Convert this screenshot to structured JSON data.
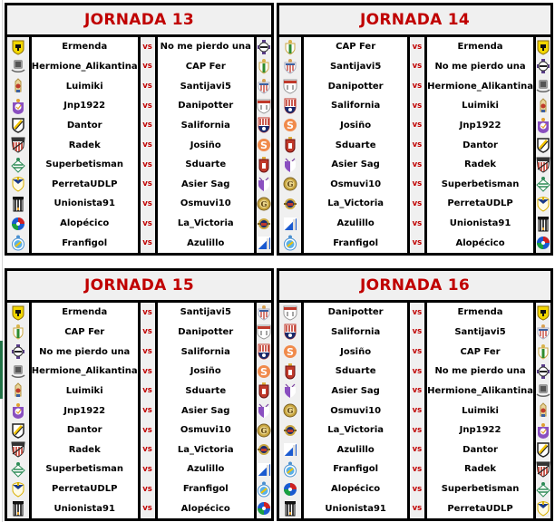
{
  "vs_label": "vs",
  "jornadas": [
    {
      "title": "JORNADA 13",
      "matches": [
        {
          "home": "Ermenda",
          "home_icon": "ermenda-crest-icon",
          "away": "No me pierdo una",
          "away_icon": "no-me-pierdo-una-crest-icon"
        },
        {
          "home": "Hermione_Alikantina",
          "home_icon": "hermione-alikantina-crest-icon",
          "away": "CAP Fer",
          "away_icon": "cap-fer-crest-icon"
        },
        {
          "home": "Luimiki",
          "home_icon": "luimiki-crest-icon",
          "away": "Santijavi5",
          "away_icon": "santijavi5-crest-icon"
        },
        {
          "home": "Jnp1922",
          "home_icon": "jnp1922-crest-icon",
          "away": "Danipotter",
          "away_icon": "danipotter-crest-icon"
        },
        {
          "home": "Dantor",
          "home_icon": "dantor-crest-icon",
          "away": "Salifornia",
          "away_icon": "salifornia-crest-icon"
        },
        {
          "home": "Radek",
          "home_icon": "radek-crest-icon",
          "away": "Josiño",
          "away_icon": "josino-crest-icon"
        },
        {
          "home": "Superbetisman",
          "home_icon": "superbetisman-crest-icon",
          "away": "Sduarte",
          "away_icon": "sduarte-crest-icon"
        },
        {
          "home": "PerretaUDLP",
          "home_icon": "perretaudlp-crest-icon",
          "away": "Asier Sag",
          "away_icon": "asier-sag-crest-icon"
        },
        {
          "home": "Unionista91",
          "home_icon": "unionista91-crest-icon",
          "away": "Osmuvi10",
          "away_icon": "osmuvi10-crest-icon"
        },
        {
          "home": "Alopécico",
          "home_icon": "alopecico-crest-icon",
          "away": "La_Victoria",
          "away_icon": "la-victoria-crest-icon"
        },
        {
          "home": "Franfigol",
          "home_icon": "franfigol-crest-icon",
          "away": "Azulillo",
          "away_icon": "azulillo-crest-icon"
        }
      ]
    },
    {
      "title": "JORNADA 14",
      "matches": [
        {
          "home": "CAP Fer",
          "home_icon": "cap-fer-crest-icon",
          "away": "Ermenda",
          "away_icon": "ermenda-crest-icon"
        },
        {
          "home": "Santijavi5",
          "home_icon": "santijavi5-crest-icon",
          "away": "No me pierdo una",
          "away_icon": "no-me-pierdo-una-crest-icon"
        },
        {
          "home": "Danipotter",
          "home_icon": "danipotter-crest-icon",
          "away": "Hermione_Alikantina",
          "away_icon": "hermione-alikantina-crest-icon"
        },
        {
          "home": "Salifornia",
          "home_icon": "salifornia-crest-icon",
          "away": "Luimiki",
          "away_icon": "luimiki-crest-icon"
        },
        {
          "home": "Josiño",
          "home_icon": "josino-crest-icon",
          "away": "Jnp1922",
          "away_icon": "jnp1922-crest-icon"
        },
        {
          "home": "Sduarte",
          "home_icon": "sduarte-crest-icon",
          "away": "Dantor",
          "away_icon": "dantor-crest-icon"
        },
        {
          "home": "Asier Sag",
          "home_icon": "asier-sag-crest-icon",
          "away": "Radek",
          "away_icon": "radek-crest-icon"
        },
        {
          "home": "Osmuvi10",
          "home_icon": "osmuvi10-crest-icon",
          "away": "Superbetisman",
          "away_icon": "superbetisman-crest-icon"
        },
        {
          "home": "La_Victoria",
          "home_icon": "la-victoria-crest-icon",
          "away": "PerretaUDLP",
          "away_icon": "perretaudlp-crest-icon"
        },
        {
          "home": "Azulillo",
          "home_icon": "azulillo-crest-icon",
          "away": "Unionista91",
          "away_icon": "unionista91-crest-icon"
        },
        {
          "home": "Franfigol",
          "home_icon": "franfigol-crest-icon",
          "away": "Alopécico",
          "away_icon": "alopecico-crest-icon"
        }
      ]
    },
    {
      "title": "JORNADA 15",
      "matches": [
        {
          "home": "Ermenda",
          "home_icon": "ermenda-crest-icon",
          "away": "Santijavi5",
          "away_icon": "santijavi5-crest-icon"
        },
        {
          "home": "CAP Fer",
          "home_icon": "cap-fer-crest-icon",
          "away": "Danipotter",
          "away_icon": "danipotter-crest-icon"
        },
        {
          "home": "No me pierdo una",
          "home_icon": "no-me-pierdo-una-crest-icon",
          "away": "Salifornia",
          "away_icon": "salifornia-crest-icon"
        },
        {
          "home": "Hermione_Alikantina",
          "home_icon": "hermione-alikantina-crest-icon",
          "away": "Josiño",
          "away_icon": "josino-crest-icon"
        },
        {
          "home": "Luimiki",
          "home_icon": "luimiki-crest-icon",
          "away": "Sduarte",
          "away_icon": "sduarte-crest-icon"
        },
        {
          "home": "Jnp1922",
          "home_icon": "jnp1922-crest-icon",
          "away": "Asier Sag",
          "away_icon": "asier-sag-crest-icon"
        },
        {
          "home": "Dantor",
          "home_icon": "dantor-crest-icon",
          "away": "Osmuvi10",
          "away_icon": "osmuvi10-crest-icon"
        },
        {
          "home": "Radek",
          "home_icon": "radek-crest-icon",
          "away": "La_Victoria",
          "away_icon": "la-victoria-crest-icon"
        },
        {
          "home": "Superbetisman",
          "home_icon": "superbetisman-crest-icon",
          "away": "Azulillo",
          "away_icon": "azulillo-crest-icon"
        },
        {
          "home": "PerretaUDLP",
          "home_icon": "perretaudlp-crest-icon",
          "away": "Franfigol",
          "away_icon": "franfigol-crest-icon"
        },
        {
          "home": "Unionista91",
          "home_icon": "unionista91-crest-icon",
          "away": "Alopécico",
          "away_icon": "alopecico-crest-icon"
        }
      ]
    },
    {
      "title": "JORNADA 16",
      "matches": [
        {
          "home": "Danipotter",
          "home_icon": "danipotter-crest-icon",
          "away": "Ermenda",
          "away_icon": "ermenda-crest-icon"
        },
        {
          "home": "Salifornia",
          "home_icon": "salifornia-crest-icon",
          "away": "Santijavi5",
          "away_icon": "santijavi5-crest-icon"
        },
        {
          "home": "Josiño",
          "home_icon": "josino-crest-icon",
          "away": "CAP Fer",
          "away_icon": "cap-fer-crest-icon"
        },
        {
          "home": "Sduarte",
          "home_icon": "sduarte-crest-icon",
          "away": "No me pierdo una",
          "away_icon": "no-me-pierdo-una-crest-icon"
        },
        {
          "home": "Asier Sag",
          "home_icon": "asier-sag-crest-icon",
          "away": "Hermione_Alikantina",
          "away_icon": "hermione-alikantina-crest-icon"
        },
        {
          "home": "Osmuvi10",
          "home_icon": "osmuvi10-crest-icon",
          "away": "Luimiki",
          "away_icon": "luimiki-crest-icon"
        },
        {
          "home": "La_Victoria",
          "home_icon": "la-victoria-crest-icon",
          "away": "Jnp1922",
          "away_icon": "jnp1922-crest-icon"
        },
        {
          "home": "Azulillo",
          "home_icon": "azulillo-crest-icon",
          "away": "Dantor",
          "away_icon": "dantor-crest-icon"
        },
        {
          "home": "Franfigol",
          "home_icon": "franfigol-crest-icon",
          "away": "Radek",
          "away_icon": "radek-crest-icon"
        },
        {
          "home": "Alopécico",
          "home_icon": "alopecico-crest-icon",
          "away": "Superbetisman",
          "away_icon": "superbetisman-crest-icon"
        },
        {
          "home": "Unionista91",
          "home_icon": "unionista91-crest-icon",
          "away": "PerretaUDLP",
          "away_icon": "perretaudlp-crest-icon"
        }
      ]
    }
  ],
  "colors": {
    "title": "#c00000",
    "vs": "#c00000",
    "header_bg": "#f0f0f0",
    "border": "#000000"
  }
}
